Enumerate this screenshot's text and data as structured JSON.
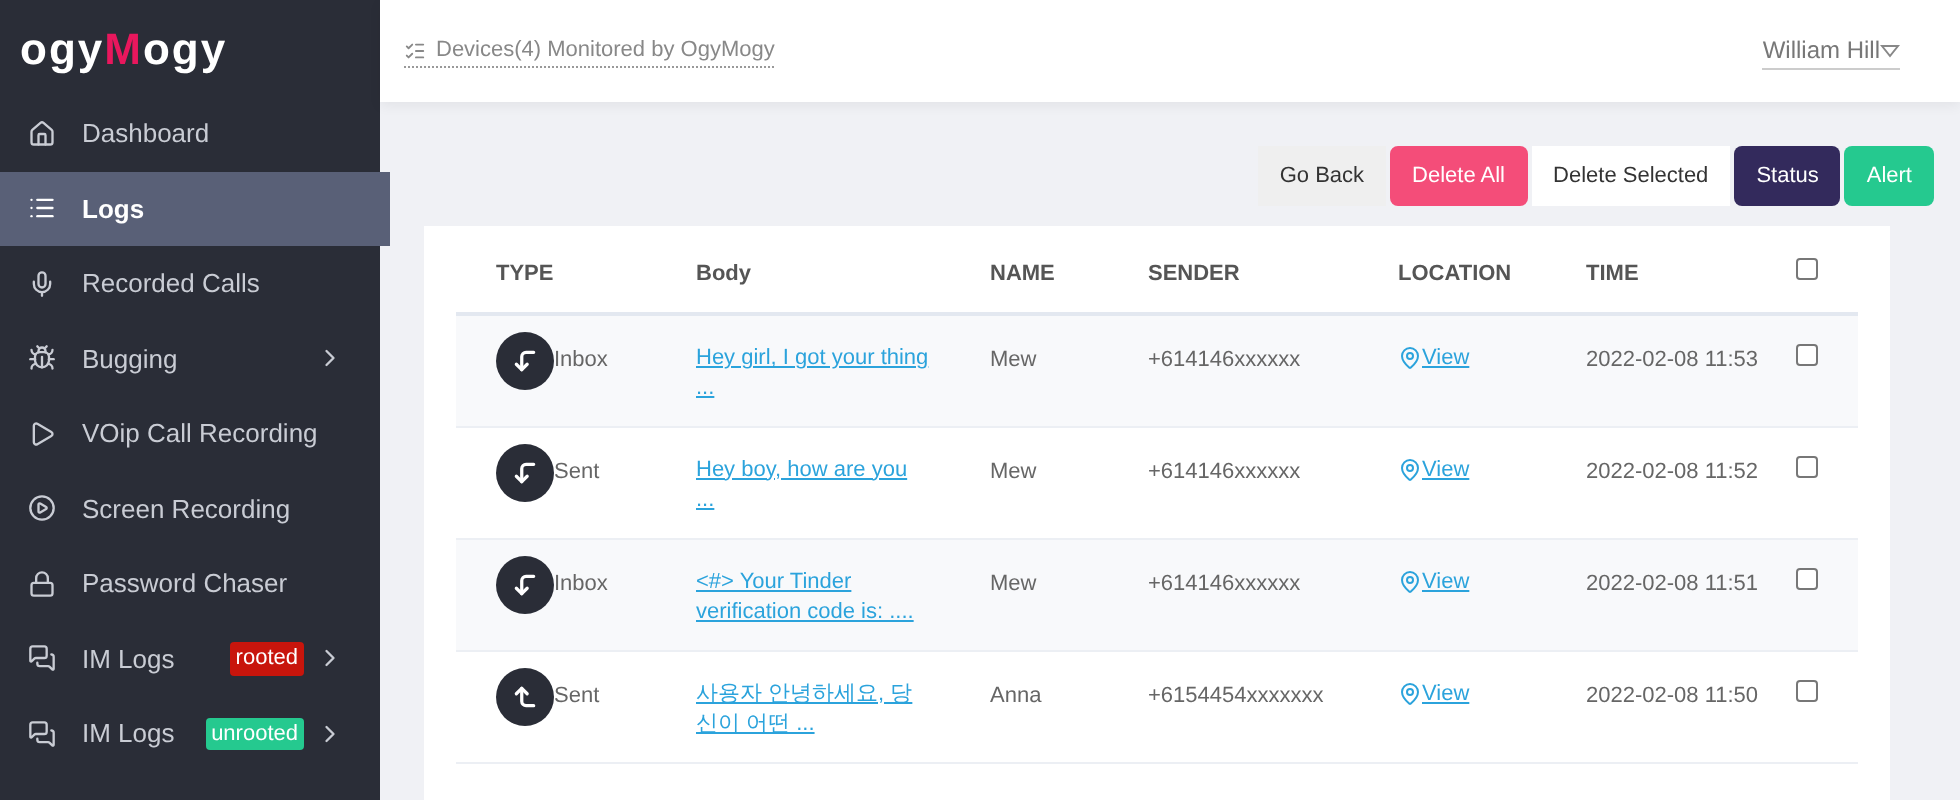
{
  "logo": {
    "left": "ogy",
    "mark": "M",
    "right": "ogy"
  },
  "sidebar": {
    "items": [
      {
        "label": "Dashboard",
        "selected": false,
        "submenu": false
      },
      {
        "label": "Logs",
        "selected": true,
        "submenu": false
      },
      {
        "label": "Recorded Calls",
        "selected": false,
        "submenu": false
      },
      {
        "label": "Bugging",
        "selected": false,
        "submenu": true
      },
      {
        "label": "VOip Call Recording",
        "selected": false,
        "submenu": false
      },
      {
        "label": "Screen Recording",
        "selected": false,
        "submenu": false
      },
      {
        "label": "Password Chaser",
        "selected": false,
        "submenu": false
      },
      {
        "label": "IM Logs",
        "selected": false,
        "submenu": true,
        "badge": {
          "text": "rooted",
          "color": "#c8150c"
        }
      },
      {
        "label": "IM Logs",
        "selected": false,
        "submenu": true,
        "badge": {
          "text": "unrooted",
          "color": "#25c98f"
        }
      }
    ]
  },
  "header": {
    "devices": "Devices(4) Monitored by OgyMogy",
    "user": "William Hill"
  },
  "buttons": [
    {
      "label": "Go Back",
      "kind": "light"
    },
    {
      "label": "Delete All",
      "kind": "danger"
    },
    {
      "label": "Delete Selected",
      "kind": "white"
    },
    {
      "label": "Status",
      "kind": "dark"
    },
    {
      "label": "Alert",
      "kind": "success"
    }
  ],
  "table": {
    "columns": [
      "TYPE",
      "Body",
      "NAME",
      "SENDER",
      "LOCATION",
      "TIME"
    ],
    "select_all_checked": false,
    "rows": [
      {
        "kind": "incoming",
        "type": "Inbox",
        "body": "Hey girl, I got your thing ...",
        "name": "Mew",
        "sender": "+614146xxxxxx",
        "location": "View",
        "time": "2022-02-08 11:53",
        "checked": false
      },
      {
        "kind": "incoming",
        "type": "Sent",
        "body": "Hey boy, how are you ...",
        "name": "Mew",
        "sender": "+614146xxxxxx",
        "location": "View",
        "time": "2022-02-08 11:52",
        "checked": false
      },
      {
        "kind": "incoming",
        "type": "Inbox",
        "body": "<#> Your Tinder verification code is: ....",
        "name": "Mew",
        "sender": "+614146xxxxxx",
        "location": "View",
        "time": "2022-02-08 11:51",
        "checked": false
      },
      {
        "kind": "outgoing",
        "type": "Sent",
        "body": "사용자 안녕하세요, 당신이 어떤 ...",
        "name": "Anna",
        "sender": "+6154454xxxxxxx",
        "location": "View",
        "time": "2022-02-08 11:50",
        "checked": false
      }
    ]
  }
}
